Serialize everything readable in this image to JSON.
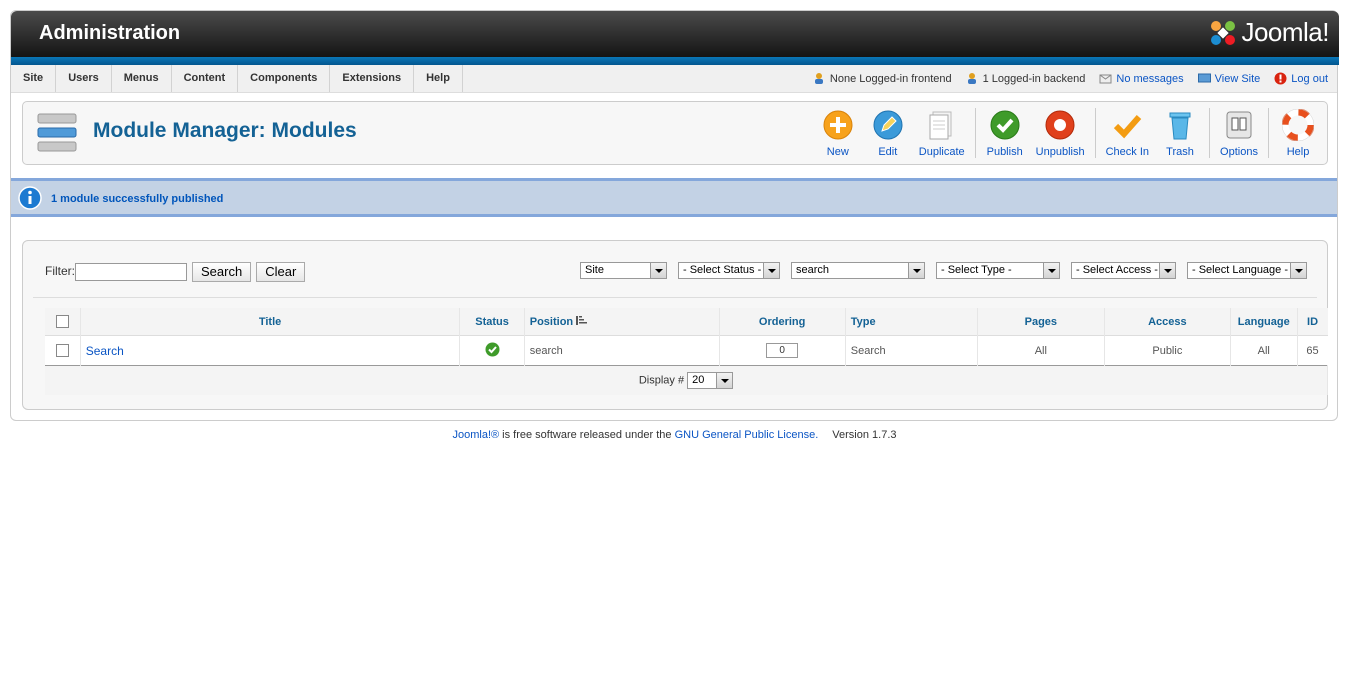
{
  "header": {
    "title": "Administration",
    "logo_text": "Joomla!"
  },
  "menu": [
    "Site",
    "Users",
    "Menus",
    "Content",
    "Components",
    "Extensions",
    "Help"
  ],
  "status": {
    "frontend": "None Logged-in frontend",
    "backend": "1 Logged-in backend",
    "messages": "No messages",
    "view_site": "View Site",
    "logout": "Log out"
  },
  "toolbar": {
    "title": "Module Manager: Modules",
    "buttons": {
      "new": "New",
      "edit": "Edit",
      "duplicate": "Duplicate",
      "publish": "Publish",
      "unpublish": "Unpublish",
      "checkin": "Check In",
      "trash": "Trash",
      "options": "Options",
      "help": "Help"
    }
  },
  "message": "1 module successfully published",
  "filter": {
    "label": "Filter:",
    "value": "",
    "search_button": "Search",
    "clear_button": "Clear",
    "client": "Site",
    "status": "- Select Status -",
    "position": "search",
    "type": "- Select Type -",
    "access": "- Select Access -",
    "language": "- Select Language -"
  },
  "table": {
    "columns": {
      "title": "Title",
      "status": "Status",
      "position": "Position",
      "ordering": "Ordering",
      "type": "Type",
      "pages": "Pages",
      "access": "Access",
      "language": "Language",
      "id": "ID"
    },
    "rows": [
      {
        "title": "Search",
        "status": "published",
        "position": "search",
        "ordering": "0",
        "type": "Search",
        "pages": "All",
        "access": "Public",
        "language": "All",
        "id": "65"
      }
    ],
    "display_label": "Display #",
    "display_value": "20"
  },
  "footer": {
    "joomla": "Joomla!®",
    "text1": " is free software released under the ",
    "license": "GNU General Public License.",
    "version": "Version 1.7.3"
  },
  "colors": {
    "brand_blue": "#146295",
    "link": "#0b55c4",
    "message_bg": "#c3d2e5"
  }
}
